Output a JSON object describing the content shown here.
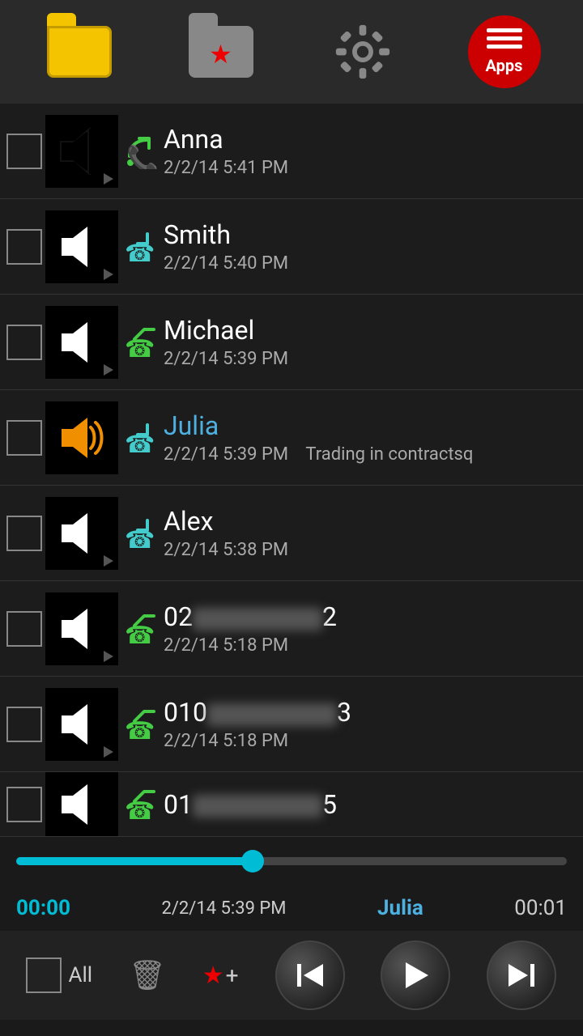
{
  "toolbar": {
    "apps_label": "Apps"
  },
  "calls": [
    {
      "id": 1,
      "name": "Anna",
      "name_color": "white",
      "date": "2/2/14 5:41 PM",
      "call_direction": "outgoing",
      "note": "",
      "active": false
    },
    {
      "id": 2,
      "name": "Smith",
      "name_color": "white",
      "date": "2/2/14 5:40 PM",
      "call_direction": "incoming",
      "note": "",
      "active": false
    },
    {
      "id": 3,
      "name": "Michael",
      "name_color": "white",
      "date": "2/2/14 5:39 PM",
      "call_direction": "outgoing",
      "note": "",
      "active": false
    },
    {
      "id": 4,
      "name": "Julia",
      "name_color": "blue",
      "date": "2/2/14 5:39 PM",
      "call_direction": "incoming",
      "note": "Trading in contractsq",
      "active": true
    },
    {
      "id": 5,
      "name": "Alex",
      "name_color": "white",
      "date": "2/2/14 5:38 PM",
      "call_direction": "incoming",
      "note": "",
      "active": false
    },
    {
      "id": 6,
      "name": "02X…2",
      "name_color": "white",
      "date": "2/2/14 5:18 PM",
      "call_direction": "outgoing",
      "note": "",
      "active": false,
      "blurred": true
    },
    {
      "id": 7,
      "name": "010X…3",
      "name_color": "white",
      "date": "2/2/14 5:18 PM",
      "call_direction": "outgoing",
      "note": "",
      "active": false,
      "blurred": true
    },
    {
      "id": 8,
      "name": "01X…5",
      "name_color": "white",
      "date": "",
      "call_direction": "outgoing",
      "note": "",
      "active": false,
      "blurred": true,
      "partial": true
    }
  ],
  "player": {
    "time_current": "00:00",
    "date_info": "2/2/14 5:39 PM",
    "name": "Julia",
    "time_total": "00:01",
    "progress_pct": 43
  },
  "bottom": {
    "all_label": "All",
    "skip_prev_label": "⏮",
    "play_label": "▶",
    "skip_next_label": "⏭"
  }
}
